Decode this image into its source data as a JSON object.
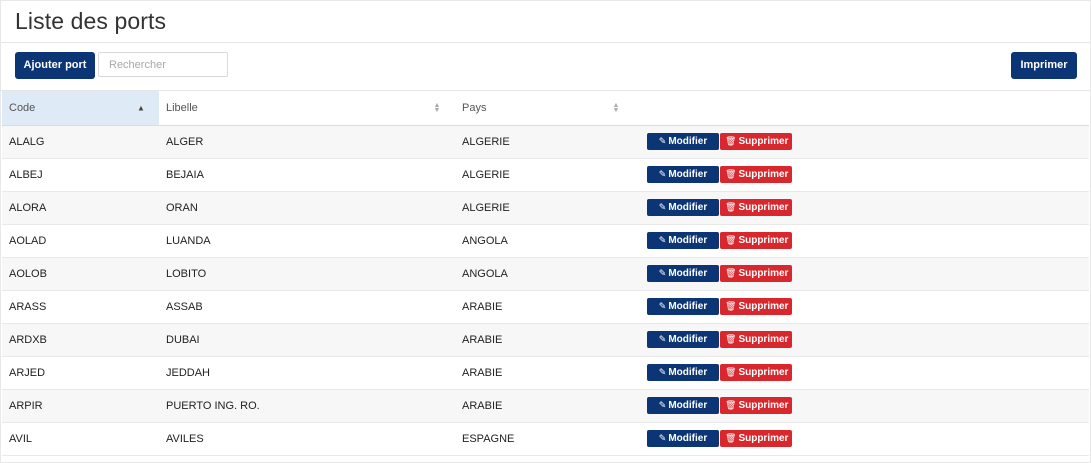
{
  "header": {
    "title": "Liste des ports"
  },
  "toolbar": {
    "add_label": "Ajouter port",
    "search_placeholder": "Rechercher",
    "search_value": "",
    "print_label": "Imprimer"
  },
  "table": {
    "columns": [
      "Code",
      "Libelle",
      "Pays"
    ],
    "sort": {
      "column": "Code",
      "direction": "asc"
    },
    "actions": {
      "edit_label": "Modifier",
      "delete_label": "Supprimer"
    },
    "rows": [
      [
        "ALALG",
        "ALGER",
        "ALGERIE"
      ],
      [
        "ALBEJ",
        "BEJAIA",
        "ALGERIE"
      ],
      [
        "ALORA",
        "ORAN",
        "ALGERIE"
      ],
      [
        "AOLAD",
        "LUANDA",
        "ANGOLA"
      ],
      [
        "AOLOB",
        "LOBITO",
        "ANGOLA"
      ],
      [
        "ARASS",
        "ASSAB",
        "ARABIE"
      ],
      [
        "ARDXB",
        "DUBAI",
        "ARABIE"
      ],
      [
        "ARJED",
        "JEDDAH",
        "ARABIE"
      ],
      [
        "ARPIR",
        "PUERTO ING. RO.",
        "ARABIE"
      ],
      [
        "AVIL",
        "AVILES",
        "ESPAGNE"
      ]
    ]
  },
  "icons": {
    "edit": "edit-icon",
    "delete": "trash-icon",
    "sort_asc": "sort-asc-icon",
    "sort_both": "sort-both-icon"
  },
  "colors": {
    "primary": "#0b3574",
    "danger": "#d9272e",
    "sorted_header": "#deeaf5"
  }
}
